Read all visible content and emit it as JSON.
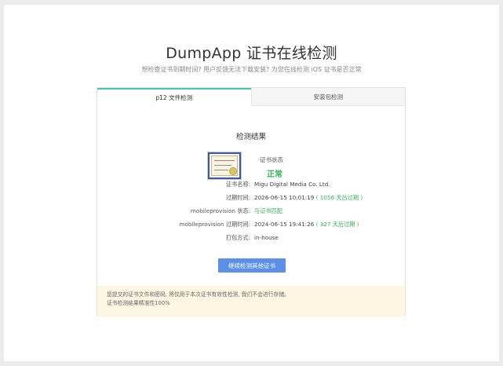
{
  "header": {
    "title": "DumpApp 证书在线检测",
    "subtitle": "想检查证书到期时间? 用户反馈无法下载安装? 为您在线检测 iOS 证书是否正常"
  },
  "tabs": [
    {
      "label": "p12 文件检测",
      "active": true
    },
    {
      "label": "安装包检测",
      "active": false
    }
  ],
  "result": {
    "title": "检测结果",
    "status_label": "证书状态",
    "status_value": "正常",
    "fields": [
      {
        "key": "证书名称:",
        "value": "Migu Digital Media Co. Ltd.",
        "note": ""
      },
      {
        "key": "过期时间:",
        "value": "2026-06-15 10:01:19",
        "note": "( 1056 天后过期 )"
      },
      {
        "key": "mobileprovision 状态:",
        "value": "",
        "note": "与证书匹配"
      },
      {
        "key": "mobileprovision 过期时间:",
        "value": "2024-06-15 19:41:26",
        "note": "( 327 天后过期 )"
      },
      {
        "key": "打包方式:",
        "value": "in-house",
        "note": ""
      }
    ],
    "button_label": "继续检测其他证书"
  },
  "notice": {
    "line1": "您提交的证书文件和密码, 将仅用于本次证书有效性检测, 我们不会进行存储。",
    "line2": "证书检测结果精准性100%"
  },
  "colors": {
    "accent_tab": "#45c5b5",
    "status_green": "#3bb35b",
    "button_blue": "#5b8fe8",
    "notice_bg": "#fdf6e3"
  },
  "icons": {
    "certificate": "certificate-image-icon"
  }
}
